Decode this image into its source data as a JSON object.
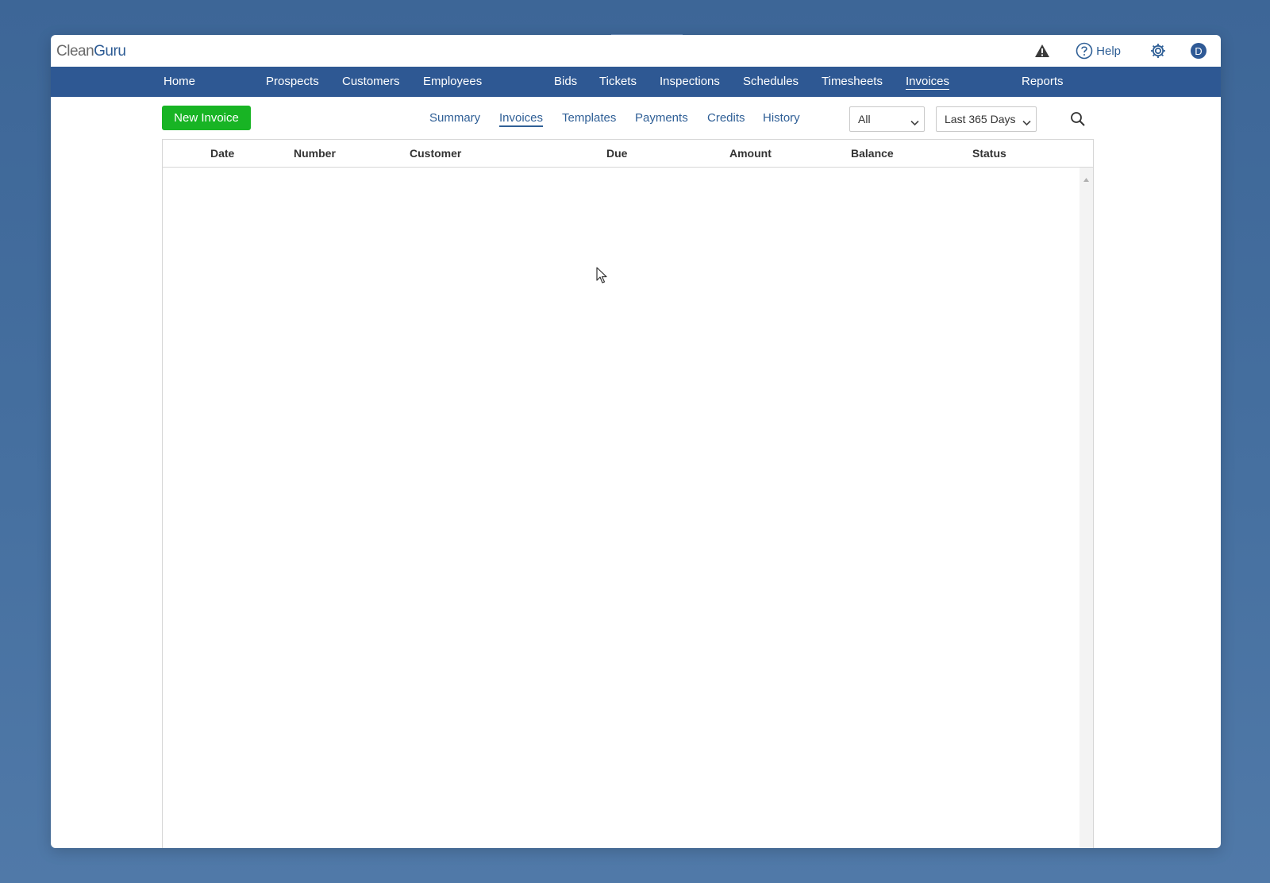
{
  "app": {
    "logo_part1": "Clean",
    "logo_part2": "Guru",
    "help_label": "Help",
    "avatar_initial": "D"
  },
  "nav": {
    "items": [
      "Home",
      "Prospects",
      "Customers",
      "Employees",
      "Bids",
      "Tickets",
      "Inspections",
      "Schedules",
      "Timesheets",
      "Invoices",
      "Reports"
    ],
    "active": "Invoices"
  },
  "toolbar": {
    "new_invoice_label": "New Invoice",
    "subnav": [
      "Summary",
      "Invoices",
      "Templates",
      "Payments",
      "Credits",
      "History"
    ],
    "active_subnav": "Invoices",
    "filter_status": "All",
    "filter_range": "Last 365 Days"
  },
  "table": {
    "columns": [
      "Date",
      "Number",
      "Customer",
      "Due",
      "Amount",
      "Balance",
      "Status"
    ],
    "rows": []
  },
  "colors": {
    "nav_bg": "#2e5893",
    "new_button": "#18b424",
    "link": "#2f5f96"
  },
  "icons": [
    "warning-icon",
    "help-circle-icon",
    "gear-icon",
    "search-icon",
    "chevron-down-icon"
  ]
}
